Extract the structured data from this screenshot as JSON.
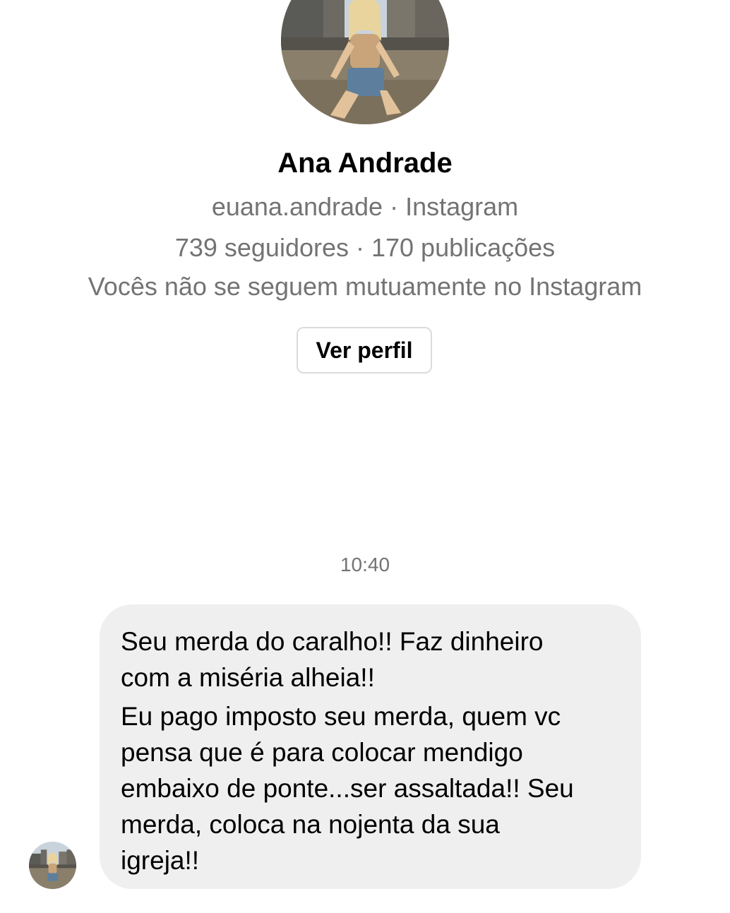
{
  "profile": {
    "avatar": "profile-photo",
    "name": "Ana Andrade",
    "handle_line": "euana.andrade · Instagram",
    "stats_line": "739 seguidores · 170 publicações",
    "mutual_line": "Vocês não se seguem mutuamente no Instagram",
    "view_profile_label": "Ver perfil"
  },
  "conversation": {
    "timestamp": "10:40",
    "message": {
      "lines": [
        "Seu merda do caralho!! Faz dinheiro",
        "com a miséria alheia!!",
        "Eu pago imposto seu merda, quem vc",
        "pensa que é para colocar mendigo",
        "embaixo de ponte...ser assaltada!! Seu",
        "merda, coloca na nojenta da sua",
        "igreja!!"
      ]
    },
    "sender_avatar": "profile-photo"
  },
  "colors": {
    "bubble": "#efefef",
    "secondary_text": "#737373",
    "button_border": "#dbdbdb"
  }
}
